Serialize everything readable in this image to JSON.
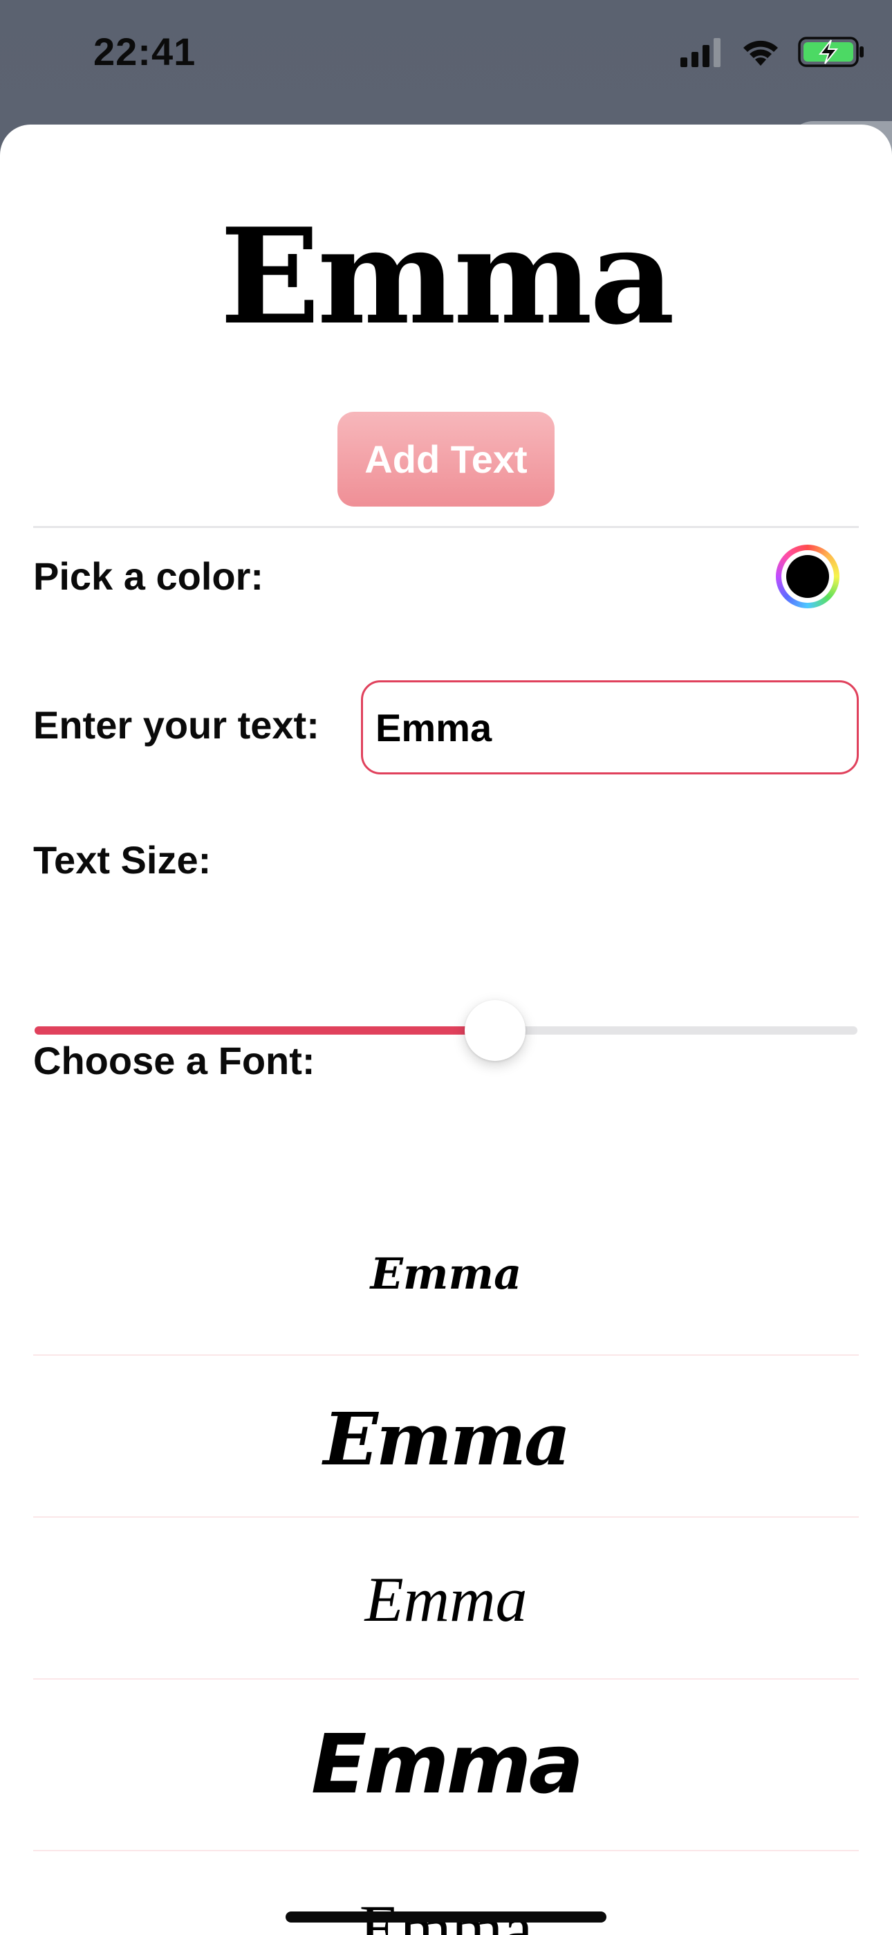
{
  "status_bar": {
    "time": "22:41",
    "icons": [
      "signal-icon",
      "wifi-icon",
      "battery-charging-icon"
    ],
    "battery_color": "#4cd964"
  },
  "preview": {
    "text": "Emma"
  },
  "add_text_button": {
    "label": "Add Text",
    "color": "#ef8f96"
  },
  "color_picker": {
    "label": "Pick a color:",
    "selected_color": "#000000"
  },
  "text_entry": {
    "label": "Enter your text:",
    "value": "Emma",
    "border_color": "#e0415c"
  },
  "text_size": {
    "label": "Text Size:",
    "value_fraction": 0.56,
    "accent_color": "#e0415c"
  },
  "fonts": {
    "label": "Choose a Font:",
    "options": [
      {
        "text": "Emma",
        "style": "script-thin"
      },
      {
        "text": "Emma",
        "style": "script-bold"
      },
      {
        "text": "Emma",
        "style": "handwritten"
      },
      {
        "text": "Emma",
        "style": "brush-italic"
      },
      {
        "text": "Emma",
        "style": "serif-light"
      }
    ]
  }
}
